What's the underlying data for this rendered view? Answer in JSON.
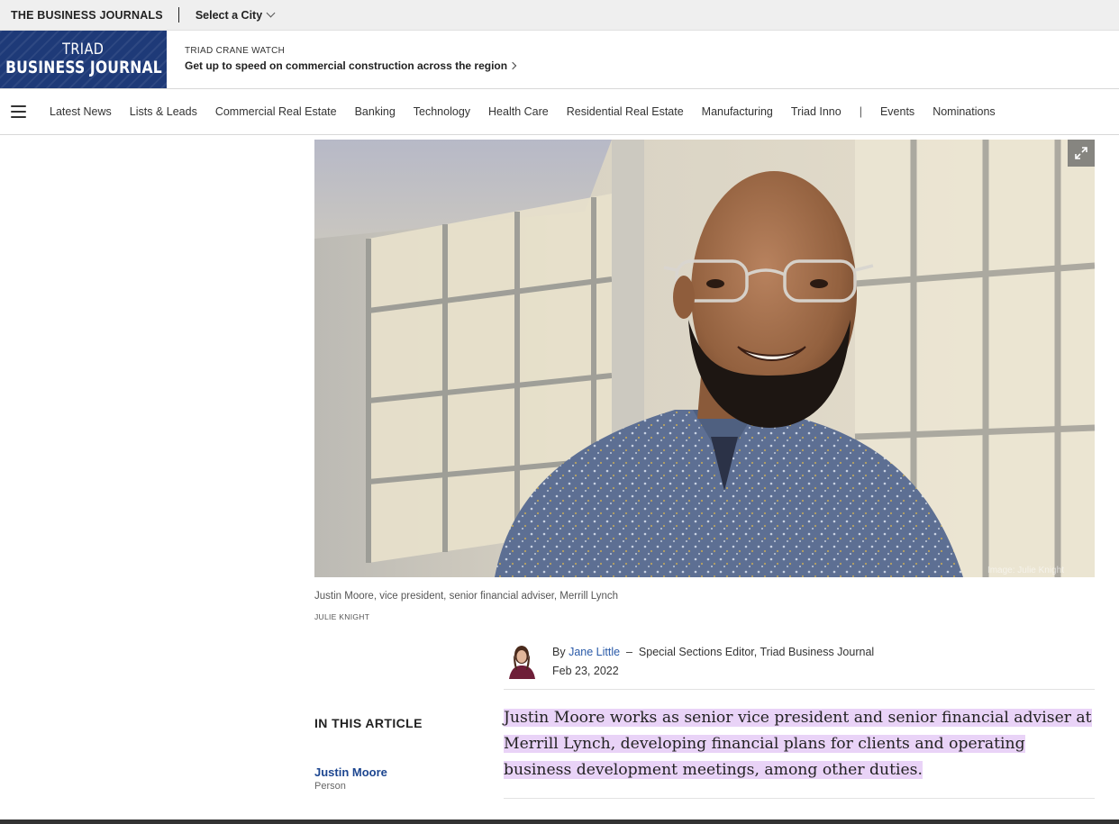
{
  "topbar": {
    "brand": "THE BUSINESS JOURNALS",
    "city_select": "Select a City"
  },
  "logo": {
    "line1": "TRIAD",
    "line2": "BUSINESS JOURNAL"
  },
  "promo": {
    "kicker": "TRIAD CRANE WATCH",
    "headline": "Get up to speed on commercial construction across the region"
  },
  "nav": {
    "items": [
      "Latest News",
      "Lists & Leads",
      "Commercial Real Estate",
      "Banking",
      "Technology",
      "Health Care",
      "Residential Real Estate",
      "Manufacturing",
      "Triad Inno"
    ],
    "divider": "|",
    "secondary": [
      "Events",
      "Nominations"
    ]
  },
  "hero": {
    "overlay_credit": "Image: Julie Knight",
    "caption": "Justin Moore, vice president, senior financial adviser, Merrill Lynch",
    "credit": "JULIE KNIGHT"
  },
  "byline": {
    "prefix": "By",
    "author": "Jane Little",
    "dash": "–",
    "role": "Special Sections Editor, Triad Business Journal",
    "date": "Feb 23, 2022"
  },
  "in_this_article": {
    "title": "IN THIS ARTICLE",
    "entity_name": "Justin Moore",
    "entity_type": "Person"
  },
  "article": {
    "lead": "Justin Moore works as senior vice president and senior financial adviser at Merrill Lynch, developing financial plans for clients and operating business development meetings, among other duties."
  },
  "colors": {
    "brand_blue": "#1e3a78",
    "link_blue": "#2a5aa8",
    "highlight": "#e9d3f7"
  }
}
